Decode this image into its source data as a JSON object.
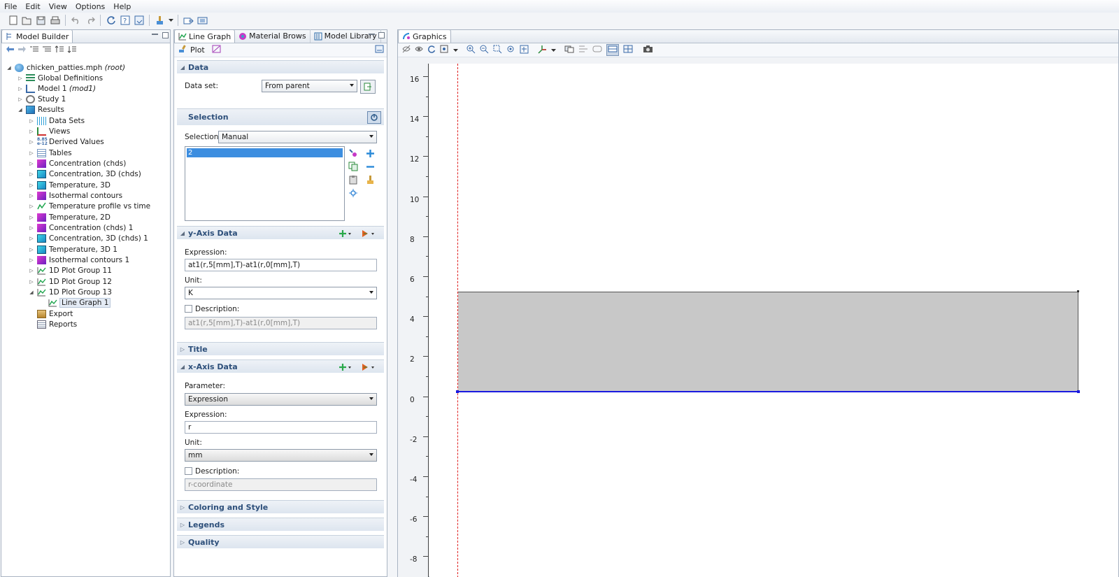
{
  "menu": [
    "File",
    "Edit",
    "View",
    "Options",
    "Help"
  ],
  "toolbar_icons": [
    "new-file-icon",
    "open-icon",
    "save-icon",
    "print-icon",
    "undo-icon",
    "redo-icon",
    "refresh-icon",
    "help-icon",
    "help-book-icon",
    "paint-brush-icon",
    "export-icon",
    "settings-icon"
  ],
  "model_builder": {
    "tab_label": "Model Builder",
    "tree": [
      {
        "label": "chicken_patties.mph",
        "suffix": "(root)",
        "level": 0,
        "expanded": true,
        "icon": "root-icon"
      },
      {
        "label": "Global Definitions",
        "level": 1,
        "icon": "global-definitions-icon"
      },
      {
        "label": "Model 1",
        "suffix": "(mod1)",
        "level": 1,
        "icon": "model-icon"
      },
      {
        "label": "Study 1",
        "level": 1,
        "icon": "study-icon"
      },
      {
        "label": "Results",
        "level": 1,
        "expanded": true,
        "icon": "results-icon"
      },
      {
        "label": "Data Sets",
        "level": 2,
        "icon": "data-sets-icon"
      },
      {
        "label": "Views",
        "level": 2,
        "icon": "views-icon"
      },
      {
        "label": "Derived Values",
        "level": 2,
        "icon": "derived-values-icon"
      },
      {
        "label": "Tables",
        "level": 2,
        "icon": "tables-icon"
      },
      {
        "label": "Concentration (chds)",
        "level": 2,
        "icon": "plot-2d-icon"
      },
      {
        "label": "Concentration, 3D (chds)",
        "level": 2,
        "icon": "plot-3d-icon"
      },
      {
        "label": "Temperature, 3D",
        "level": 2,
        "icon": "plot-3d-icon"
      },
      {
        "label": "Isothermal contours",
        "level": 2,
        "icon": "plot-2d-icon"
      },
      {
        "label": "Temperature profile vs time",
        "level": 2,
        "icon": "plot-1d-icon"
      },
      {
        "label": "Temperature, 2D",
        "level": 2,
        "icon": "plot-2d-icon"
      },
      {
        "label": "Concentration (chds) 1",
        "level": 2,
        "icon": "plot-2d-icon"
      },
      {
        "label": "Concentration, 3D (chds) 1",
        "level": 2,
        "icon": "plot-3d-icon"
      },
      {
        "label": "Temperature, 3D 1",
        "level": 2,
        "icon": "plot-3d-icon"
      },
      {
        "label": "Isothermal contours 1",
        "level": 2,
        "icon": "plot-2d-icon"
      },
      {
        "label": "1D Plot Group 11",
        "level": 2,
        "icon": "plot-1d-icon"
      },
      {
        "label": "1D Plot Group 12",
        "level": 2,
        "icon": "plot-1d-icon"
      },
      {
        "label": "1D Plot Group 13",
        "level": 2,
        "expanded": true,
        "icon": "plot-1d-icon"
      },
      {
        "label": "Line Graph 1",
        "level": 3,
        "selected": true,
        "icon": "line-graph-icon"
      },
      {
        "label": "Export",
        "level": 2,
        "icon": "export-icon"
      },
      {
        "label": "Reports",
        "level": 2,
        "icon": "reports-icon"
      }
    ]
  },
  "settings": {
    "tabs": [
      "Line Graph",
      "Material Brows",
      "Model Library"
    ],
    "plot_label": "Plot",
    "data": {
      "header": "Data",
      "dataset_label": "Data set:",
      "dataset_value": "From parent"
    },
    "selection": {
      "header": "Selection",
      "mode_label": "Selection:",
      "mode_value": "Manual",
      "items": [
        "2"
      ]
    },
    "y_axis": {
      "header": "y-Axis Data",
      "expression_label": "Expression:",
      "expression": "at1(r,5[mm],T)-at1(r,0[mm],T)",
      "unit_label": "Unit:",
      "unit": "K",
      "description_label": "Description:",
      "description": "at1(r,5[mm],T)-at1(r,0[mm],T)"
    },
    "title": {
      "header": "Title"
    },
    "x_axis": {
      "header": "x-Axis Data",
      "parameter_label": "Parameter:",
      "parameter": "Expression",
      "expression_label": "Expression:",
      "expression": "r",
      "unit_label": "Unit:",
      "unit": "mm",
      "description_label": "Description:",
      "description": "r-coordinate"
    },
    "collapsed": [
      "Coloring and Style",
      "Legends",
      "Quality"
    ]
  },
  "graphics": {
    "tab_label": "Graphics",
    "y_ticks": [
      "16",
      "14",
      "12",
      "10",
      "8",
      "6",
      "4",
      "2",
      "0",
      "-2",
      "-4",
      "-6",
      "-8"
    ]
  },
  "colors": {
    "accent": "#2d4f7a",
    "selection_blue": "#3d8ee0",
    "axis_red": "#e02020",
    "edge_blue": "#1a1ae0",
    "domain_fill": "#c8c8c8"
  }
}
